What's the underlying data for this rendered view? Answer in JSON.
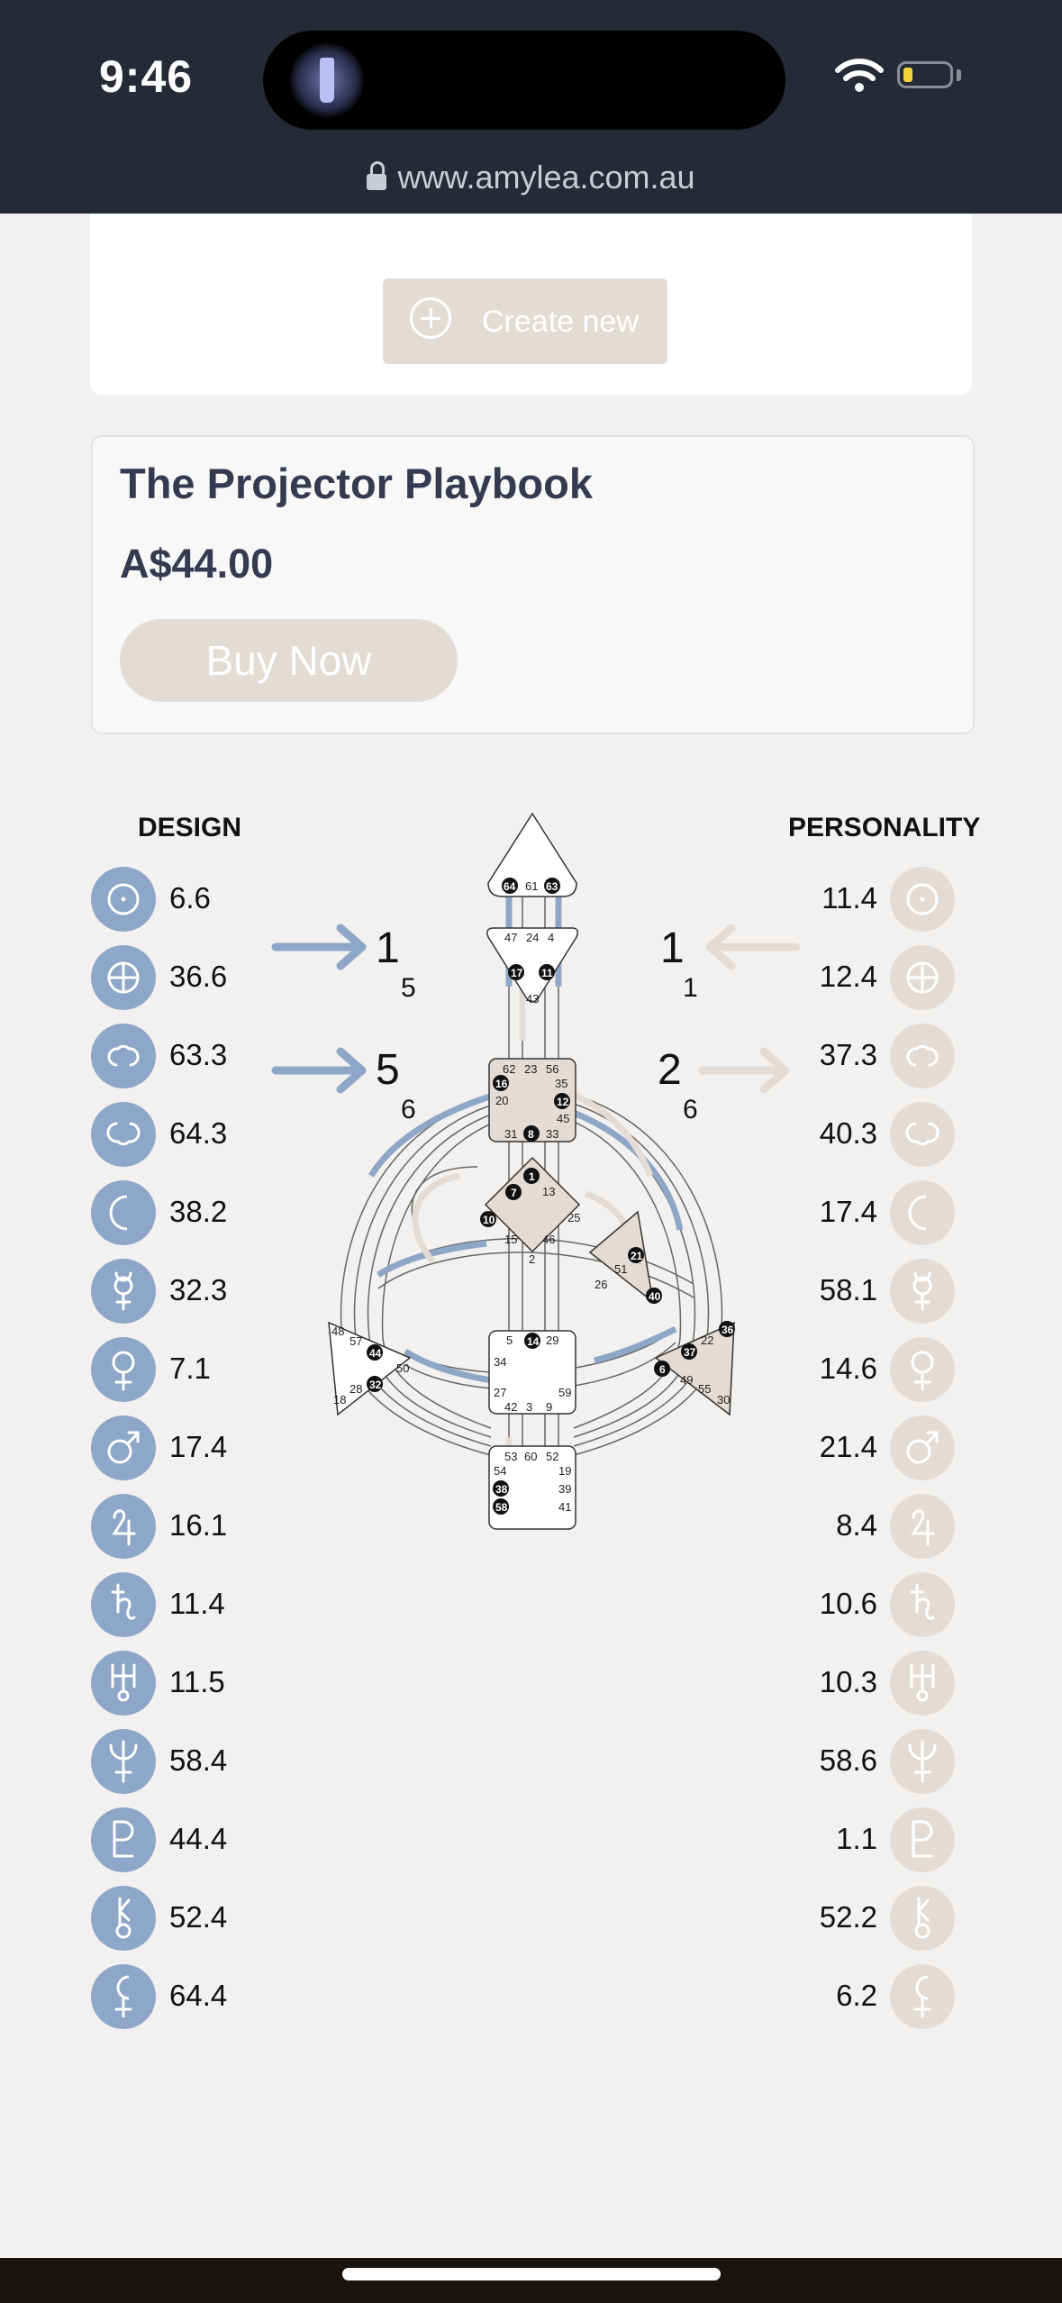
{
  "status": {
    "time": "9:46"
  },
  "browser": {
    "url": "www.amylea.com.au"
  },
  "create_button": {
    "label": "Create new"
  },
  "product": {
    "title": "The Projector Playbook",
    "price": "A$44.00",
    "buy_label": "Buy Now"
  },
  "chart": {
    "design_header": "DESIGN",
    "personality_header": "PERSONALITY",
    "design_arrow_top": {
      "big": "1",
      "small": "5"
    },
    "design_arrow_bottom": {
      "big": "5",
      "small": "6"
    },
    "pers_arrow_top": {
      "big": "1",
      "small": "1"
    },
    "pers_arrow_bottom": {
      "big": "2",
      "small": "6"
    },
    "design_color": "#8ea6c8",
    "personality_color": "#e4dcd4",
    "planets": [
      {
        "icon": "sun-icon",
        "design": "6.6",
        "personality": "11.4"
      },
      {
        "icon": "earth-icon",
        "design": "36.6",
        "personality": "12.4"
      },
      {
        "icon": "north-node-icon",
        "design": "63.3",
        "personality": "37.3"
      },
      {
        "icon": "south-node-icon",
        "design": "64.3",
        "personality": "40.3"
      },
      {
        "icon": "moon-icon",
        "design": "38.2",
        "personality": "17.4"
      },
      {
        "icon": "mercury-icon",
        "design": "32.3",
        "personality": "58.1"
      },
      {
        "icon": "venus-icon",
        "design": "7.1",
        "personality": "14.6"
      },
      {
        "icon": "mars-icon",
        "design": "17.4",
        "personality": "21.4"
      },
      {
        "icon": "jupiter-icon",
        "design": "16.1",
        "personality": "8.4"
      },
      {
        "icon": "saturn-icon",
        "design": "11.4",
        "personality": "10.6"
      },
      {
        "icon": "uranus-icon",
        "design": "11.5",
        "personality": "10.3"
      },
      {
        "icon": "neptune-icon",
        "design": "58.4",
        "personality": "58.6"
      },
      {
        "icon": "pluto-icon",
        "design": "44.4",
        "personality": "1.1"
      },
      {
        "icon": "chiron-icon",
        "design": "52.4",
        "personality": "52.2"
      },
      {
        "icon": "lilith-icon",
        "design": "64.4",
        "personality": "6.2"
      }
    ]
  }
}
